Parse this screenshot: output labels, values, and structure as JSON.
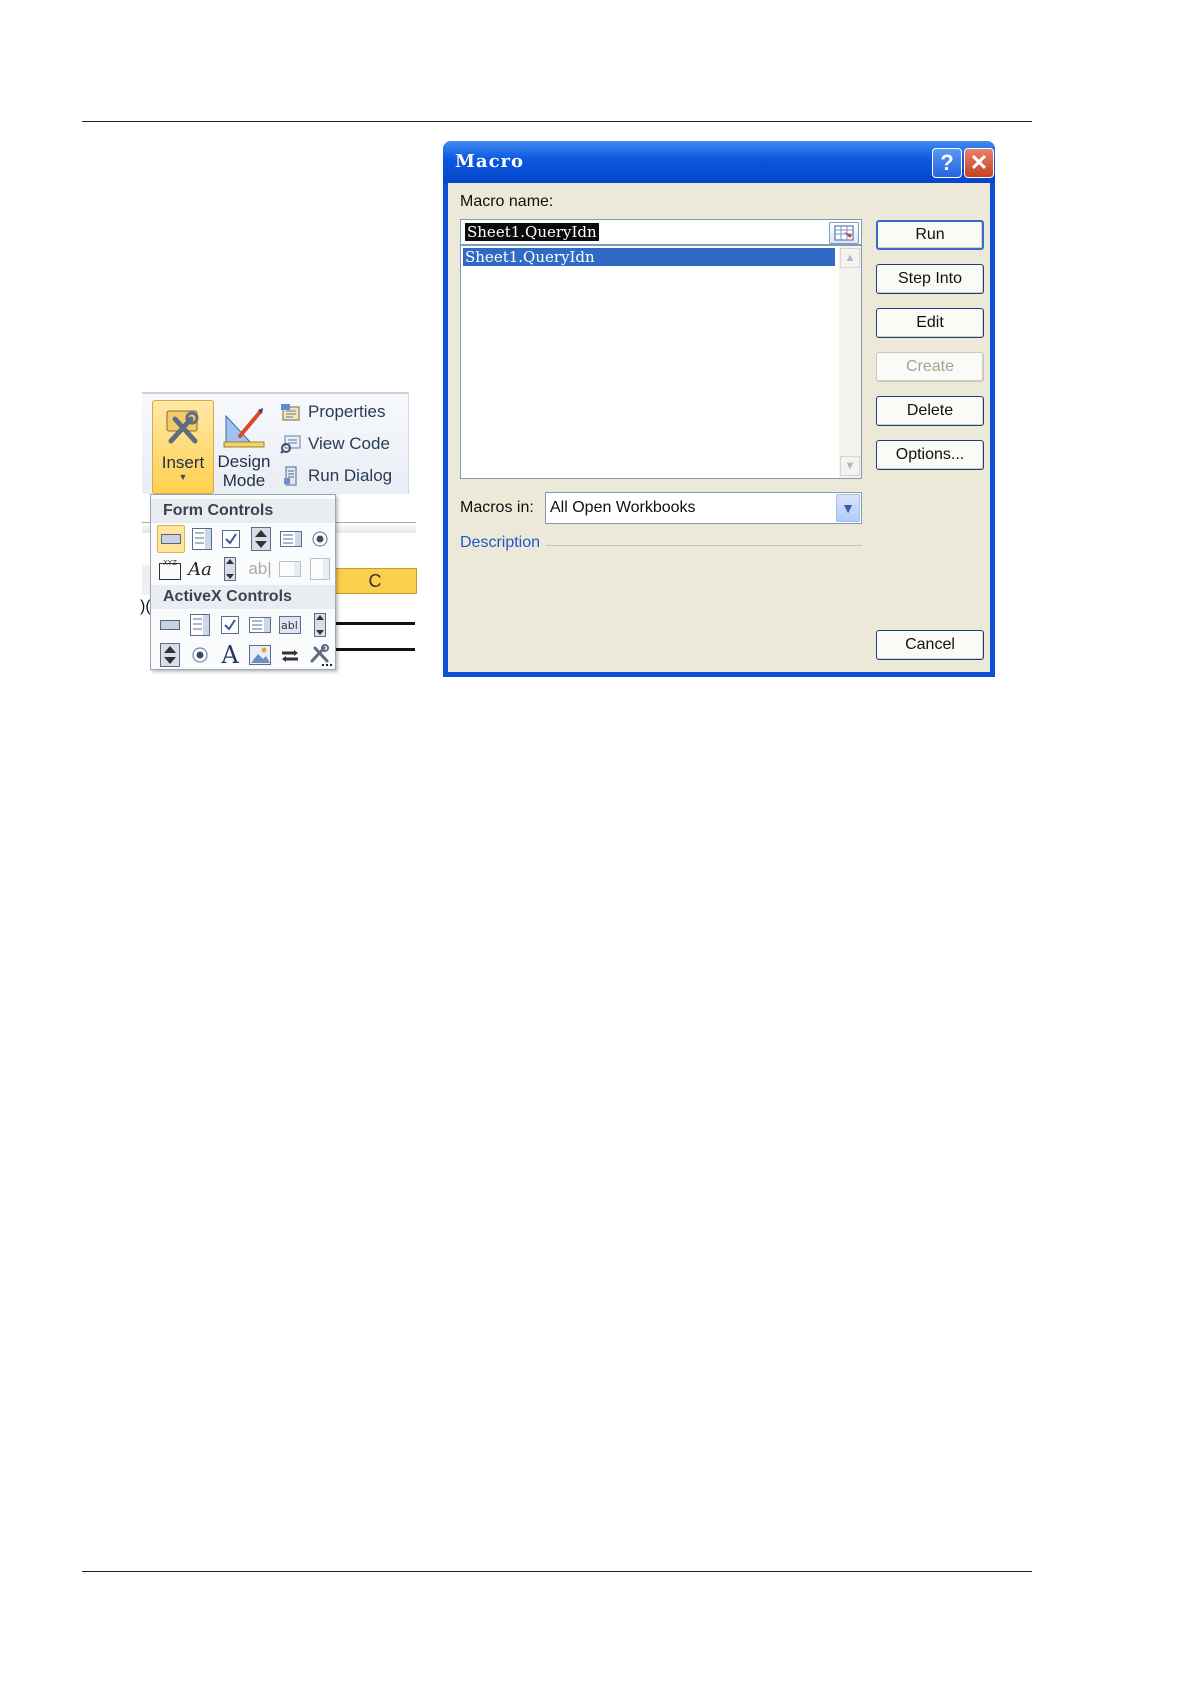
{
  "ribbon": {
    "insert_label": "Insert",
    "design_label_line1": "Design",
    "design_label_line2": "Mode",
    "properties_label": "Properties",
    "view_code_label": "View Code",
    "run_dialog_label": "Run Dialog"
  },
  "gallery": {
    "form_controls_label": "Form Controls",
    "activex_controls_label": "ActiveX Controls"
  },
  "grid": {
    "column_header": "C",
    "row_fragment": ")("
  },
  "dialog": {
    "title": "Macro",
    "help_glyph": "?",
    "close_glyph": "✕",
    "macro_name_label": "Macro name:",
    "macro_name_value": "Sheet1.QueryIdn",
    "macro_list": [
      "Sheet1.QueryIdn"
    ],
    "macros_in_label": "Macros in:",
    "macros_in_value": "All Open Workbooks",
    "description_label": "Description",
    "buttons": {
      "run": "Run",
      "step_into": "Step Into",
      "edit": "Edit",
      "create": "Create",
      "delete": "Delete",
      "options": "Options...",
      "cancel": "Cancel"
    }
  }
}
